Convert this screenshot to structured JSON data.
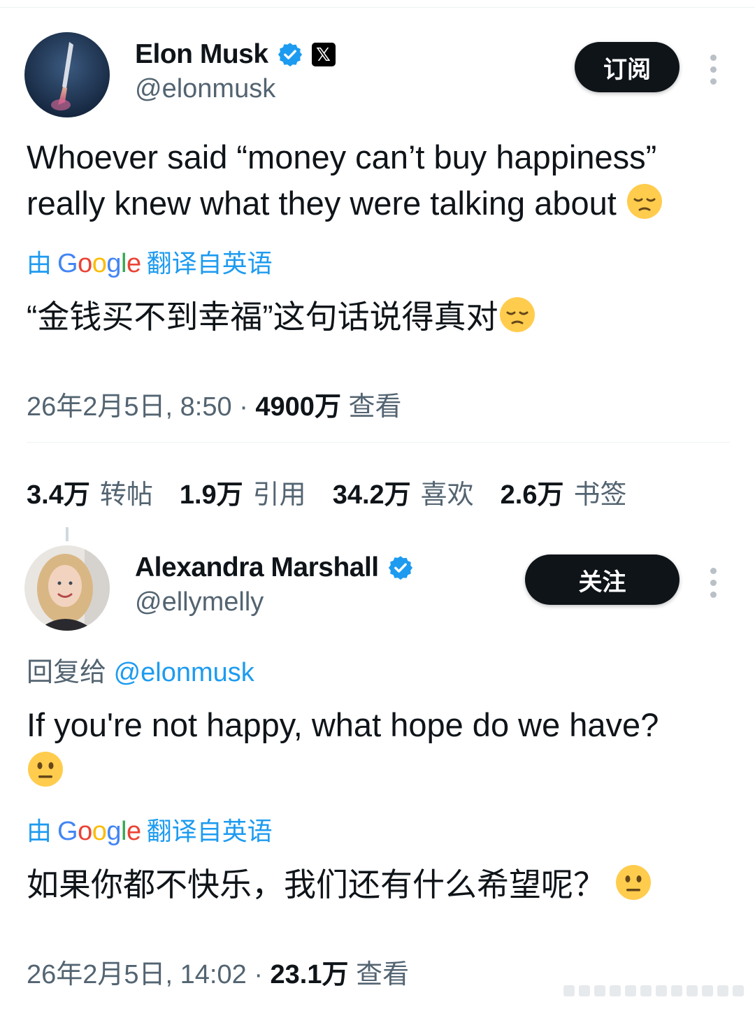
{
  "tweet": {
    "author": {
      "display_name": "Elon Musk",
      "handle": "@elonmusk",
      "verified_icon": "verified-badge-icon",
      "affiliate_icon": "x-logo-icon"
    },
    "subscribe_label": "订阅",
    "text_line1": "Whoever said “money can’t buy happiness”",
    "text_line2": "really knew what they were talking about",
    "emoji": "pensive-face",
    "translation": {
      "prefix": "由",
      "brand": "Google",
      "suffix": "翻译自英语"
    },
    "translated_text": "“金钱买不到幸福”这句话说得真对",
    "timestamp": "26年2月5日, 8:50",
    "separator": "·",
    "views_count": "4900万",
    "views_label": "查看",
    "stats": [
      {
        "count": "3.4万",
        "label": "转帖"
      },
      {
        "count": "1.9万",
        "label": "引用"
      },
      {
        "count": "34.2万",
        "label": "喜欢"
      },
      {
        "count": "2.6万",
        "label": "书签"
      }
    ]
  },
  "reply": {
    "author": {
      "display_name": "Alexandra Marshall",
      "handle": "@ellymelly",
      "verified_icon": "verified-badge-icon"
    },
    "follow_label": "关注",
    "reply_to_prefix": "回复给",
    "reply_to_handle": "@elonmusk",
    "text": "If you're not happy, what hope do we have?",
    "emoji": "neutral-face",
    "translation": {
      "prefix": "由",
      "brand": "Google",
      "suffix": "翻译自英语"
    },
    "translated_text": "如果你都不快乐，我们还有什么希望呢？",
    "timestamp": "26年2月5日, 14:02",
    "separator": "·",
    "views_count": "23.1万",
    "views_label": "查看"
  },
  "colors": {
    "accent": "#1d9bf0",
    "text": "#0f1419",
    "secondary": "#536471",
    "button": "#0f1419"
  }
}
